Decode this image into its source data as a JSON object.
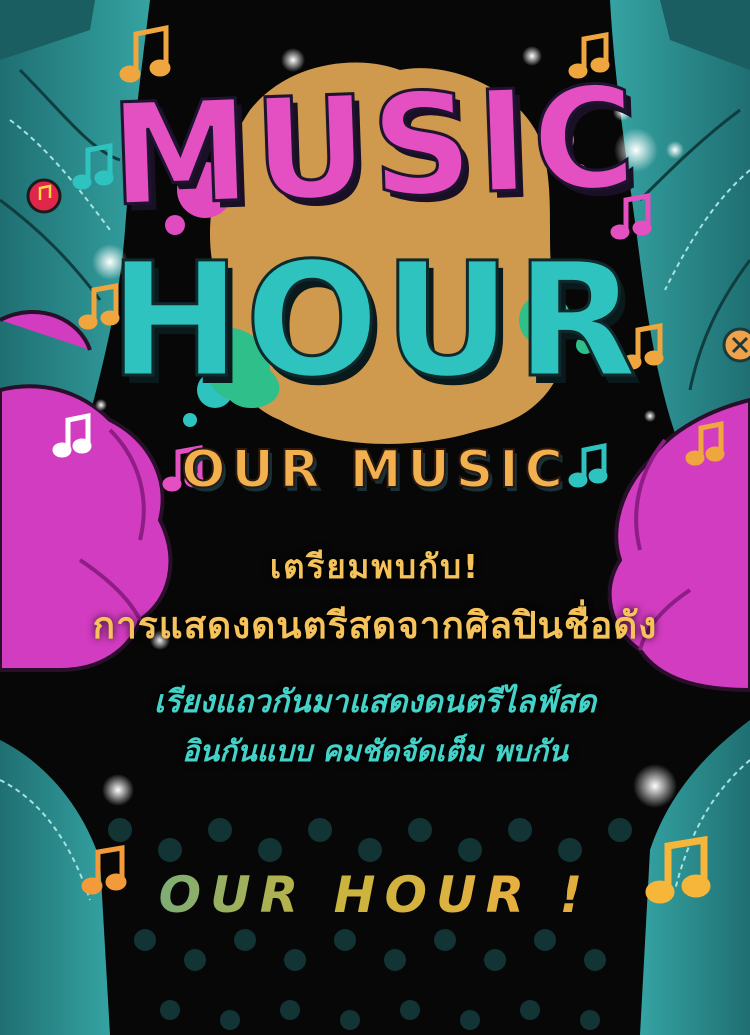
{
  "poster": {
    "title_line1": "MUSIC",
    "title_line2": "HOUR",
    "subtitle": "OUR MUSIC",
    "headline": "เตรียมพบกับ!",
    "subheadline": "การแสดงดนตรีสดจากศิลปินชื่อดัง",
    "desc_line1": "เรียงแถวกันมาแสดงดนตรีไลฟ์สด",
    "desc_line2": "อินกันแบบ คมชัดจัดเต็ม พบกัน",
    "tagline": "OUR HOUR !"
  },
  "colors": {
    "background": "#070708",
    "magenta": "#e44fc2",
    "teal": "#2fc3c0",
    "gold": "#f6c25a",
    "denim": "#2e8d8e",
    "orange_note": "#f39a3a"
  },
  "icons": [
    "music-note-icon",
    "sparkle-icon",
    "button-pin-icon",
    "paint-splatter"
  ]
}
